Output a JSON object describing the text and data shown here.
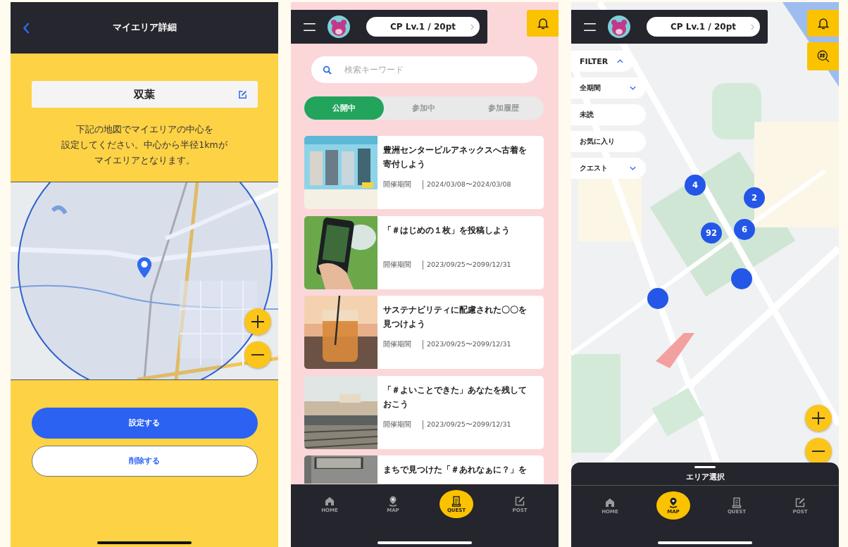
{
  "area_detail": {
    "title": "マイエリア詳細",
    "area_name": "双葉",
    "instructions": [
      "下記の地図でマイエリアの中心を",
      "設定してください。中心から半径1kmが",
      "マイエリアとなります。"
    ],
    "buttons": [
      {
        "label": "設定する",
        "kind": "primary"
      },
      {
        "label": "削除する",
        "kind": "secondary"
      }
    ]
  },
  "quest_list": {
    "points": "CP Lv.1 / 20pt",
    "search": {
      "placeholder": "検索キーワード"
    },
    "tabs": [
      {
        "label": "公開中",
        "selected": true
      },
      {
        "label": "参加中",
        "selected": false
      },
      {
        "label": "参加履歴",
        "selected": false
      }
    ],
    "quests": [
      {
        "title": "豊洲センタービルアネックスへ古着を寄付しよう",
        "period_label": "開催期間",
        "period": "2024/03/08〜2024/03/08"
      },
      {
        "title": "「＃はじめの１枚」を投稿しよう",
        "period_label": "開催期間",
        "period": "2023/09/25〜2099/12/31"
      },
      {
        "title": "サステナビリティに配慮された〇〇を見つけよう",
        "period_label": "開催期間",
        "period": "2023/09/25〜2099/12/31"
      },
      {
        "title": "「＃よいことできた」あなたを残しておこう",
        "period_label": "開催期間",
        "period": "2023/09/25〜2099/12/31"
      },
      {
        "title": "まちで見つけた「＃あれなぁに？」を"
      }
    ],
    "nav": [
      {
        "label": "HOME",
        "kind": "home",
        "selected": false
      },
      {
        "label": "MAP",
        "kind": "map",
        "selected": false
      },
      {
        "label": "QUEST",
        "kind": "quest",
        "selected": true
      },
      {
        "label": "POST",
        "kind": "post",
        "selected": false
      }
    ]
  },
  "map": {
    "points": "CP Lv.1 / 20pt",
    "filter": {
      "label": "FILTER",
      "expanded": true
    },
    "chips": [
      {
        "label": "全期間",
        "kind": "dropdown"
      },
      {
        "label": "未読",
        "kind": "toggle"
      },
      {
        "label": "お気に入り",
        "kind": "toggle"
      },
      {
        "label": "クエスト",
        "kind": "dropdown"
      }
    ],
    "markers": [
      {
        "kind": "cluster",
        "count": "4"
      },
      {
        "kind": "cluster",
        "count": "2"
      },
      {
        "kind": "cluster",
        "count": "92"
      },
      {
        "kind": "cluster",
        "count": "6"
      },
      {
        "kind": "single"
      },
      {
        "kind": "single"
      }
    ],
    "sheet_title": "エリア選択",
    "nav": [
      {
        "label": "HOME",
        "kind": "home",
        "selected": false
      },
      {
        "label": "MAP",
        "kind": "map",
        "selected": true
      },
      {
        "label": "QUEST",
        "kind": "quest",
        "selected": false
      },
      {
        "label": "POST",
        "kind": "post",
        "selected": false
      }
    ]
  }
}
